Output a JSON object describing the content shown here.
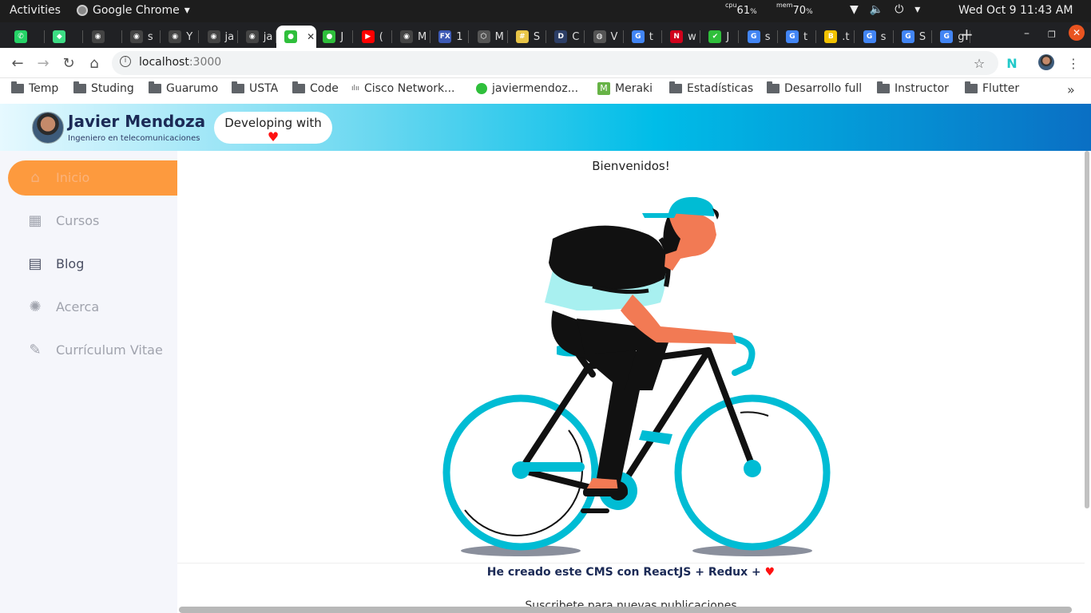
{
  "system_bar": {
    "activities": "Activities",
    "app_name": "Google Chrome",
    "cpu_label": "cpu",
    "cpu_value": "61",
    "mem_label": "mem",
    "mem_value": "70",
    "percent": "%",
    "clock": "Wed Oct 9  11:43 AM"
  },
  "tabs": [
    {
      "label": "",
      "icon": "whatsapp-icon",
      "color": "#25d366"
    },
    {
      "label": "",
      "icon": "diamond-icon",
      "color": "#3ddc84"
    },
    {
      "label": "",
      "icon": "github-icon",
      "color": "#444"
    },
    {
      "label": "s",
      "icon": "github-icon",
      "color": "#444"
    },
    {
      "label": "Y",
      "icon": "github-icon",
      "color": "#444"
    },
    {
      "label": "ja",
      "icon": "github-icon",
      "color": "#444"
    },
    {
      "label": "ja",
      "icon": "github-icon",
      "color": "#444"
    },
    {
      "label": "",
      "icon": "green-ball-icon",
      "color": "#2fbf3b",
      "active": true
    },
    {
      "label": "J",
      "icon": "green-ball-icon",
      "color": "#2fbf3b"
    },
    {
      "label": "(",
      "icon": "youtube-icon",
      "color": "#ff0000"
    },
    {
      "label": "M",
      "icon": "github-icon",
      "color": "#444"
    },
    {
      "label": "1",
      "icon": "fx-icon",
      "color": "#3d5ab5"
    },
    {
      "label": "M",
      "icon": "circle-icon",
      "color": "#555"
    },
    {
      "label": "S",
      "icon": "slack-icon",
      "color": "#e8c547"
    },
    {
      "label": "C",
      "icon": "d-icon",
      "color": "#2c3e66"
    },
    {
      "label": "V",
      "icon": "globe-icon",
      "color": "#555"
    },
    {
      "label": "t",
      "icon": "google-icon",
      "color": "#4285f4"
    },
    {
      "label": "w",
      "icon": "n-icon",
      "color": "#d0021b"
    },
    {
      "label": "J",
      "icon": "green-check-icon",
      "color": "#2fbf3b"
    },
    {
      "label": "s",
      "icon": "google-icon",
      "color": "#4285f4"
    },
    {
      "label": "t",
      "icon": "google-icon",
      "color": "#4285f4"
    },
    {
      "label": ".t",
      "icon": "b-icon",
      "color": "#f2c200"
    },
    {
      "label": "s",
      "icon": "google-icon",
      "color": "#4285f4"
    },
    {
      "label": "S",
      "icon": "google-icon",
      "color": "#4285f4"
    },
    {
      "label": "g",
      "icon": "google-icon",
      "color": "#4285f4"
    }
  ],
  "address_bar": {
    "host": "localhost",
    "port": ":3000"
  },
  "bookmarks": [
    {
      "label": "Temp",
      "icon": "folder-icon"
    },
    {
      "label": "Studing",
      "icon": "folder-icon"
    },
    {
      "label": "Guarumo",
      "icon": "folder-icon"
    },
    {
      "label": "USTA",
      "icon": "folder-icon"
    },
    {
      "label": "Code",
      "icon": "folder-icon"
    },
    {
      "label": "Cisco Network...",
      "icon": "cisco-icon"
    },
    {
      "label": "javiermendoz...",
      "icon": "green-ball-icon"
    },
    {
      "label": "Meraki",
      "icon": "meraki-icon"
    },
    {
      "label": "Estadísticas",
      "icon": "folder-icon"
    },
    {
      "label": "Desarrollo full",
      "icon": "folder-icon"
    },
    {
      "label": "Instructor",
      "icon": "folder-icon"
    },
    {
      "label": "Flutter",
      "icon": "folder-icon"
    }
  ],
  "header": {
    "name": "Javier Mendoza",
    "subtitle": "Ingeniero en telecomunicaciones",
    "pill_text": "Developing with",
    "heart": "♥"
  },
  "sidebar": {
    "items": [
      {
        "label": "Inicio",
        "icon": "home-icon",
        "active": true
      },
      {
        "label": "Cursos",
        "icon": "courses-icon"
      },
      {
        "label": "Blog",
        "icon": "blog-icon"
      },
      {
        "label": "Acerca",
        "icon": "about-icon"
      },
      {
        "label": "Currículum Vitae",
        "icon": "cv-icon"
      }
    ]
  },
  "main": {
    "welcome": "Bienvenidos!",
    "cms_text": "He creado este CMS con ReactJS + Redux +",
    "heart": "♥",
    "subscribe": "Suscribete para nuevas publicaciones"
  }
}
